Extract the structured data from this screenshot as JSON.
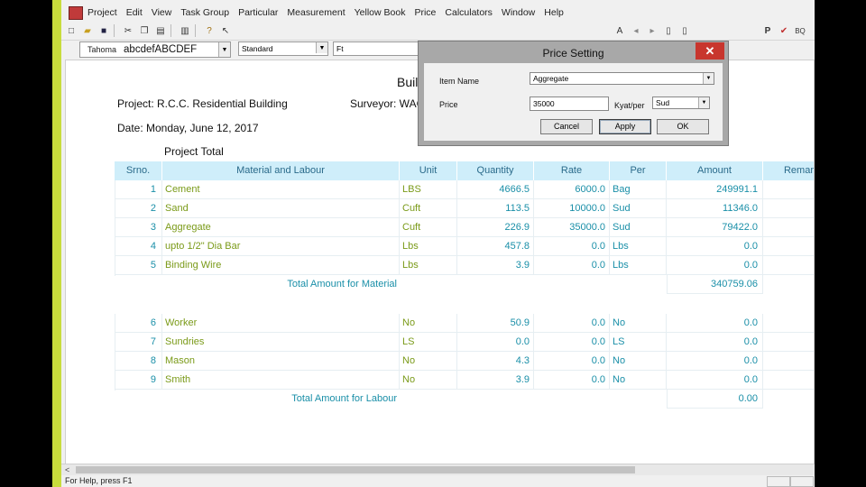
{
  "menu": [
    "Project",
    "Edit",
    "View",
    "Task Group",
    "Particular",
    "Measurement",
    "Yellow Book",
    "Price",
    "Calculators",
    "Window",
    "Help"
  ],
  "toolbar": {
    "font_name": "Tahoma",
    "font_sample": "abcdefABCDEF",
    "style": "Standard",
    "size": "Ft",
    "right_labels": [
      "P",
      "BQ"
    ]
  },
  "report": {
    "title": "Buil",
    "project": "Project: R.C.C. Residential Building",
    "surveyor": "Surveyor: WAC",
    "date": "Date: Monday, June 12, 2017",
    "section": "Project Total",
    "columns": [
      "Srno.",
      "Material and Labour",
      "Unit",
      "Quantity",
      "Rate",
      "Per",
      "Amount",
      "Remar"
    ],
    "materials": [
      {
        "srno": "1",
        "name": "Cement",
        "unit": "LBS",
        "qty": "4666.5",
        "rate": "6000.0",
        "per": "Bag",
        "amount": "249991.1"
      },
      {
        "srno": "2",
        "name": "Sand",
        "unit": "Cuft",
        "qty": "113.5",
        "rate": "10000.0",
        "per": "Sud",
        "amount": "11346.0"
      },
      {
        "srno": "3",
        "name": "Aggregate",
        "unit": "Cuft",
        "qty": "226.9",
        "rate": "35000.0",
        "per": "Sud",
        "amount": "79422.0"
      },
      {
        "srno": "4",
        "name": "upto 1/2\" Dia Bar",
        "unit": "Lbs",
        "qty": "457.8",
        "rate": "0.0",
        "per": "Lbs",
        "amount": "0.0"
      },
      {
        "srno": "5",
        "name": "Binding Wire",
        "unit": "Lbs",
        "qty": "3.9",
        "rate": "0.0",
        "per": "Lbs",
        "amount": "0.0"
      }
    ],
    "material_total_label": "Total Amount for Material",
    "material_total": "340759.06",
    "labour": [
      {
        "srno": "6",
        "name": "Worker",
        "unit": "No",
        "qty": "50.9",
        "rate": "0.0",
        "per": "No",
        "amount": "0.0"
      },
      {
        "srno": "7",
        "name": "Sundries",
        "unit": "LS",
        "qty": "0.0",
        "rate": "0.0",
        "per": "LS",
        "amount": "0.0"
      },
      {
        "srno": "8",
        "name": "Mason",
        "unit": "No",
        "qty": "4.3",
        "rate": "0.0",
        "per": "No",
        "amount": "0.0"
      },
      {
        "srno": "9",
        "name": "Smith",
        "unit": "No",
        "qty": "3.9",
        "rate": "0.0",
        "per": "No",
        "amount": "0.0"
      }
    ],
    "labour_total_label": "Total Amount for Labour",
    "labour_total": "0.00"
  },
  "dialog": {
    "title": "Price Setting",
    "close": "✕",
    "item_name_label": "Item Name",
    "item_name_value": "Aggregate",
    "price_label": "Price",
    "price_value": "35000",
    "unit_label": "Kyat/per",
    "unit_value": "Sud",
    "cancel": "Cancel",
    "apply": "Apply",
    "ok": "OK"
  },
  "status": {
    "help": "For Help, press F1"
  }
}
